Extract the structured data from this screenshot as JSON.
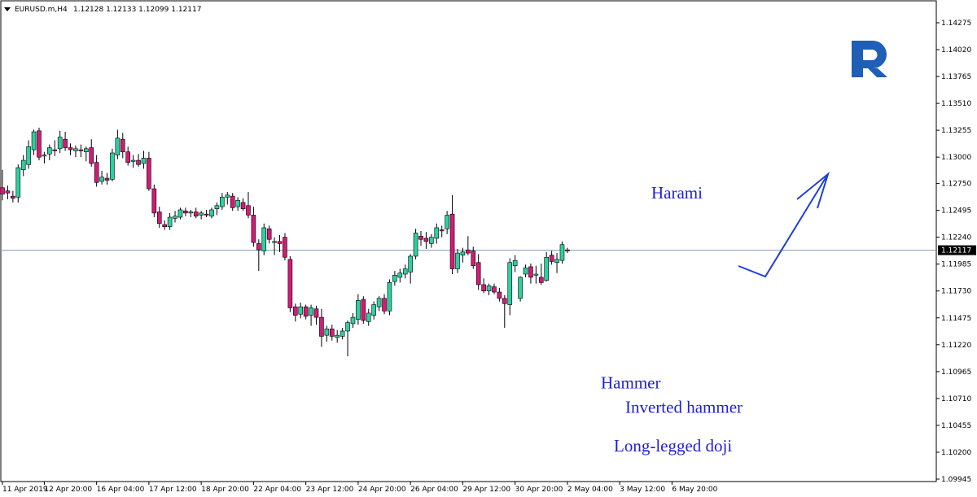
{
  "chart_data": {
    "type": "candlestick",
    "symbol_header": "EURUSD.m,H4",
    "ohlc_header": "1.12128 1.12133 1.12099 1.12117",
    "current_price": 1.12117,
    "current_price_label": "1.12117",
    "ylim": [
      1.0995,
      1.1443
    ],
    "y_ticks": [
      {
        "value": 1.14275,
        "label": "1.14275"
      },
      {
        "value": 1.1402,
        "label": "1.14020"
      },
      {
        "value": 1.13765,
        "label": "1.13765"
      },
      {
        "value": 1.1351,
        "label": "1.13510"
      },
      {
        "value": 1.13255,
        "label": "1.13255"
      },
      {
        "value": 1.13,
        "label": "1.13000"
      },
      {
        "value": 1.1275,
        "label": "1.12750"
      },
      {
        "value": 1.12495,
        "label": "1.12495"
      },
      {
        "value": 1.1224,
        "label": "1.12240"
      },
      {
        "value": 1.11985,
        "label": "1.11985"
      },
      {
        "value": 1.1173,
        "label": "1.11730"
      },
      {
        "value": 1.11475,
        "label": "1.11475"
      },
      {
        "value": 1.1122,
        "label": "1.11220"
      },
      {
        "value": 1.10965,
        "label": "1.10965"
      },
      {
        "value": 1.1071,
        "label": "1.10710"
      },
      {
        "value": 1.10455,
        "label": "1.10455"
      },
      {
        "value": 1.102,
        "label": "1.10200"
      },
      {
        "value": 1.09945,
        "label": "1.09945"
      }
    ],
    "x_ticks": [
      {
        "index": 0,
        "label": "11 Apr 2019"
      },
      {
        "index": 8,
        "label": "12 Apr 20:00"
      },
      {
        "index": 18,
        "label": "16 Apr 04:00"
      },
      {
        "index": 28,
        "label": "17 Apr 12:00"
      },
      {
        "index": 38,
        "label": "18 Apr 20:00"
      },
      {
        "index": 48,
        "label": "22 Apr 04:00"
      },
      {
        "index": 58,
        "label": "23 Apr 12:00"
      },
      {
        "index": 68,
        "label": "24 Apr 20:00"
      },
      {
        "index": 78,
        "label": "26 Apr 04:00"
      },
      {
        "index": 88,
        "label": "29 Apr 12:00"
      },
      {
        "index": 98,
        "label": "30 Apr 20:00"
      },
      {
        "index": 108,
        "label": "2 May 04:00"
      },
      {
        "index": 118,
        "label": "3 May 12:00"
      },
      {
        "index": 128,
        "label": "6 May 20:00"
      }
    ],
    "candles": [
      {
        "o": 1.1271,
        "h": 1.1288,
        "l": 1.1259,
        "c": 1.1265
      },
      {
        "o": 1.1268,
        "h": 1.1273,
        "l": 1.126,
        "c": 1.1266
      },
      {
        "o": 1.1263,
        "h": 1.1268,
        "l": 1.1257,
        "c": 1.1261
      },
      {
        "o": 1.1262,
        "h": 1.1293,
        "l": 1.1257,
        "c": 1.129
      },
      {
        "o": 1.1288,
        "h": 1.1302,
        "l": 1.1282,
        "c": 1.1297
      },
      {
        "o": 1.1293,
        "h": 1.1316,
        "l": 1.1289,
        "c": 1.131
      },
      {
        "o": 1.1307,
        "h": 1.1326,
        "l": 1.1302,
        "c": 1.1324
      },
      {
        "o": 1.1325,
        "h": 1.1328,
        "l": 1.1297,
        "c": 1.13
      },
      {
        "o": 1.1301,
        "h": 1.1305,
        "l": 1.1294,
        "c": 1.1302
      },
      {
        "o": 1.1303,
        "h": 1.1312,
        "l": 1.1297,
        "c": 1.1309
      },
      {
        "o": 1.1307,
        "h": 1.1316,
        "l": 1.1301,
        "c": 1.1306
      },
      {
        "o": 1.1308,
        "h": 1.1325,
        "l": 1.1304,
        "c": 1.1319
      },
      {
        "o": 1.1317,
        "h": 1.1324,
        "l": 1.1306,
        "c": 1.1309
      },
      {
        "o": 1.1309,
        "h": 1.1313,
        "l": 1.1302,
        "c": 1.1307
      },
      {
        "o": 1.1306,
        "h": 1.1311,
        "l": 1.13,
        "c": 1.1308
      },
      {
        "o": 1.1307,
        "h": 1.1312,
        "l": 1.13,
        "c": 1.1306
      },
      {
        "o": 1.1305,
        "h": 1.131,
        "l": 1.1296,
        "c": 1.1308
      },
      {
        "o": 1.1309,
        "h": 1.1317,
        "l": 1.1291,
        "c": 1.1294
      },
      {
        "o": 1.1295,
        "h": 1.1302,
        "l": 1.1272,
        "c": 1.1276
      },
      {
        "o": 1.1277,
        "h": 1.1287,
        "l": 1.1274,
        "c": 1.1281
      },
      {
        "o": 1.128,
        "h": 1.1285,
        "l": 1.1274,
        "c": 1.1278
      },
      {
        "o": 1.1279,
        "h": 1.1308,
        "l": 1.1277,
        "c": 1.1304
      },
      {
        "o": 1.1302,
        "h": 1.1326,
        "l": 1.1298,
        "c": 1.1318
      },
      {
        "o": 1.1317,
        "h": 1.1323,
        "l": 1.1299,
        "c": 1.1305
      },
      {
        "o": 1.1305,
        "h": 1.131,
        "l": 1.1292,
        "c": 1.1295
      },
      {
        "o": 1.1296,
        "h": 1.1302,
        "l": 1.129,
        "c": 1.1297
      },
      {
        "o": 1.1297,
        "h": 1.1303,
        "l": 1.1291,
        "c": 1.1293
      },
      {
        "o": 1.1294,
        "h": 1.1306,
        "l": 1.1289,
        "c": 1.1299
      },
      {
        "o": 1.1299,
        "h": 1.1305,
        "l": 1.1268,
        "c": 1.127
      },
      {
        "o": 1.127,
        "h": 1.1274,
        "l": 1.1243,
        "c": 1.1247
      },
      {
        "o": 1.1248,
        "h": 1.1253,
        "l": 1.1233,
        "c": 1.1237
      },
      {
        "o": 1.1236,
        "h": 1.124,
        "l": 1.1231,
        "c": 1.1234
      },
      {
        "o": 1.1234,
        "h": 1.1247,
        "l": 1.1231,
        "c": 1.1243
      },
      {
        "o": 1.1242,
        "h": 1.1249,
        "l": 1.1238,
        "c": 1.1244
      },
      {
        "o": 1.1243,
        "h": 1.1252,
        "l": 1.1241,
        "c": 1.125
      },
      {
        "o": 1.1249,
        "h": 1.1252,
        "l": 1.1244,
        "c": 1.1247
      },
      {
        "o": 1.1247,
        "h": 1.125,
        "l": 1.1243,
        "c": 1.1248
      },
      {
        "o": 1.1248,
        "h": 1.1252,
        "l": 1.1242,
        "c": 1.1244
      },
      {
        "o": 1.1245,
        "h": 1.1249,
        "l": 1.1241,
        "c": 1.1247
      },
      {
        "o": 1.1246,
        "h": 1.125,
        "l": 1.1243,
        "c": 1.1245
      },
      {
        "o": 1.1244,
        "h": 1.1252,
        "l": 1.1242,
        "c": 1.125
      },
      {
        "o": 1.1251,
        "h": 1.1257,
        "l": 1.1245,
        "c": 1.1254
      },
      {
        "o": 1.1253,
        "h": 1.1266,
        "l": 1.125,
        "c": 1.1262
      },
      {
        "o": 1.1262,
        "h": 1.1267,
        "l": 1.1255,
        "c": 1.1264
      },
      {
        "o": 1.1263,
        "h": 1.1266,
        "l": 1.1249,
        "c": 1.1252
      },
      {
        "o": 1.1253,
        "h": 1.1262,
        "l": 1.1249,
        "c": 1.1259
      },
      {
        "o": 1.1257,
        "h": 1.1261,
        "l": 1.1249,
        "c": 1.1251
      },
      {
        "o": 1.1254,
        "h": 1.1267,
        "l": 1.1242,
        "c": 1.1245
      },
      {
        "o": 1.1245,
        "h": 1.1253,
        "l": 1.1215,
        "c": 1.1219
      },
      {
        "o": 1.1218,
        "h": 1.1222,
        "l": 1.1192,
        "c": 1.1212
      },
      {
        "o": 1.1211,
        "h": 1.1237,
        "l": 1.1207,
        "c": 1.1233
      },
      {
        "o": 1.1232,
        "h": 1.1235,
        "l": 1.1218,
        "c": 1.1222
      },
      {
        "o": 1.1219,
        "h": 1.1224,
        "l": 1.1207,
        "c": 1.122
      },
      {
        "o": 1.122,
        "h": 1.1226,
        "l": 1.121,
        "c": 1.1218
      },
      {
        "o": 1.1224,
        "h": 1.1228,
        "l": 1.1202,
        "c": 1.1205
      },
      {
        "o": 1.1203,
        "h": 1.1206,
        "l": 1.1153,
        "c": 1.1157
      },
      {
        "o": 1.1158,
        "h": 1.1161,
        "l": 1.1144,
        "c": 1.115
      },
      {
        "o": 1.1151,
        "h": 1.1162,
        "l": 1.1147,
        "c": 1.1158
      },
      {
        "o": 1.1158,
        "h": 1.116,
        "l": 1.1146,
        "c": 1.1149
      },
      {
        "o": 1.115,
        "h": 1.116,
        "l": 1.114,
        "c": 1.1157
      },
      {
        "o": 1.1156,
        "h": 1.1159,
        "l": 1.1141,
        "c": 1.1148
      },
      {
        "o": 1.1148,
        "h": 1.1156,
        "l": 1.112,
        "c": 1.113
      },
      {
        "o": 1.1131,
        "h": 1.114,
        "l": 1.1125,
        "c": 1.1137
      },
      {
        "o": 1.1137,
        "h": 1.1141,
        "l": 1.1126,
        "c": 1.113
      },
      {
        "o": 1.1129,
        "h": 1.1136,
        "l": 1.1124,
        "c": 1.1131
      },
      {
        "o": 1.113,
        "h": 1.1138,
        "l": 1.1127,
        "c": 1.1135
      },
      {
        "o": 1.1135,
        "h": 1.1145,
        "l": 1.1111,
        "c": 1.1143
      },
      {
        "o": 1.1142,
        "h": 1.1152,
        "l": 1.1138,
        "c": 1.1148
      },
      {
        "o": 1.1146,
        "h": 1.117,
        "l": 1.1141,
        "c": 1.1164
      },
      {
        "o": 1.1165,
        "h": 1.1168,
        "l": 1.1142,
        "c": 1.1145
      },
      {
        "o": 1.1144,
        "h": 1.1156,
        "l": 1.114,
        "c": 1.1152
      },
      {
        "o": 1.115,
        "h": 1.1163,
        "l": 1.1146,
        "c": 1.116
      },
      {
        "o": 1.1158,
        "h": 1.1168,
        "l": 1.1154,
        "c": 1.1166
      },
      {
        "o": 1.1166,
        "h": 1.117,
        "l": 1.1151,
        "c": 1.1154
      },
      {
        "o": 1.1154,
        "h": 1.1184,
        "l": 1.115,
        "c": 1.1181
      },
      {
        "o": 1.1182,
        "h": 1.1192,
        "l": 1.1178,
        "c": 1.1188
      },
      {
        "o": 1.1186,
        "h": 1.1194,
        "l": 1.1181,
        "c": 1.119
      },
      {
        "o": 1.1189,
        "h": 1.1198,
        "l": 1.1185,
        "c": 1.1194
      },
      {
        "o": 1.1191,
        "h": 1.1208,
        "l": 1.118,
        "c": 1.1206
      },
      {
        "o": 1.1206,
        "h": 1.1232,
        "l": 1.1203,
        "c": 1.1228
      },
      {
        "o": 1.1225,
        "h": 1.123,
        "l": 1.1216,
        "c": 1.1222
      },
      {
        "o": 1.1223,
        "h": 1.1229,
        "l": 1.1213,
        "c": 1.122
      },
      {
        "o": 1.1218,
        "h": 1.1227,
        "l": 1.1214,
        "c": 1.1224
      },
      {
        "o": 1.1223,
        "h": 1.1237,
        "l": 1.1218,
        "c": 1.1233
      },
      {
        "o": 1.1231,
        "h": 1.1235,
        "l": 1.1224,
        "c": 1.123
      },
      {
        "o": 1.1232,
        "h": 1.1249,
        "l": 1.1227,
        "c": 1.1245
      },
      {
        "o": 1.1246,
        "h": 1.1264,
        "l": 1.1189,
        "c": 1.1194
      },
      {
        "o": 1.1194,
        "h": 1.1213,
        "l": 1.119,
        "c": 1.1209
      },
      {
        "o": 1.1207,
        "h": 1.1214,
        "l": 1.12,
        "c": 1.121
      },
      {
        "o": 1.1212,
        "h": 1.1225,
        "l": 1.1207,
        "c": 1.1209
      },
      {
        "o": 1.1211,
        "h": 1.1215,
        "l": 1.1194,
        "c": 1.1197
      },
      {
        "o": 1.12,
        "h": 1.1208,
        "l": 1.1174,
        "c": 1.1179
      },
      {
        "o": 1.1179,
        "h": 1.1185,
        "l": 1.1171,
        "c": 1.1173
      },
      {
        "o": 1.1173,
        "h": 1.118,
        "l": 1.1169,
        "c": 1.1178
      },
      {
        "o": 1.1177,
        "h": 1.118,
        "l": 1.117,
        "c": 1.1172
      },
      {
        "o": 1.1172,
        "h": 1.1176,
        "l": 1.1163,
        "c": 1.1166
      },
      {
        "o": 1.1166,
        "h": 1.1169,
        "l": 1.1138,
        "c": 1.1161
      },
      {
        "o": 1.116,
        "h": 1.1204,
        "l": 1.115,
        "c": 1.12
      },
      {
        "o": 1.1197,
        "h": 1.1207,
        "l": 1.1191,
        "c": 1.1202
      },
      {
        "o": 1.1166,
        "h": 1.1187,
        "l": 1.1163,
        "c": 1.1186
      },
      {
        "o": 1.1189,
        "h": 1.1198,
        "l": 1.1186,
        "c": 1.1195
      },
      {
        "o": 1.1196,
        "h": 1.1199,
        "l": 1.118,
        "c": 1.1186
      },
      {
        "o": 1.1188,
        "h": 1.1197,
        "l": 1.118,
        "c": 1.1189
      },
      {
        "o": 1.1186,
        "h": 1.1199,
        "l": 1.1179,
        "c": 1.1181
      },
      {
        "o": 1.1183,
        "h": 1.121,
        "l": 1.1182,
        "c": 1.1205
      },
      {
        "o": 1.1207,
        "h": 1.1211,
        "l": 1.1198,
        "c": 1.1201
      },
      {
        "o": 1.12,
        "h": 1.1209,
        "l": 1.119,
        "c": 1.1203
      },
      {
        "o": 1.1202,
        "h": 1.122,
        "l": 1.1199,
        "c": 1.1217
      },
      {
        "o": 1.1212,
        "h": 1.1214,
        "l": 1.1209,
        "c": 1.1211
      }
    ],
    "annotations": [
      {
        "text": "Harami",
        "anchor_price": 1.1266
      },
      {
        "text": "Hammer",
        "anchor_price": 1.1086
      },
      {
        "text": "Inverted hammer",
        "anchor_price": 1.1063
      },
      {
        "text": "Long-legged doji",
        "anchor_price": 1.1026
      }
    ],
    "colors": {
      "bull": "#2ecfa0",
      "bear": "#d11c77",
      "wick": "#000000",
      "price_line": "#7f9cbc",
      "annotation": "#1f1fd6",
      "arrow": "#1f3fd6",
      "logo": "#1f5fb5"
    }
  }
}
